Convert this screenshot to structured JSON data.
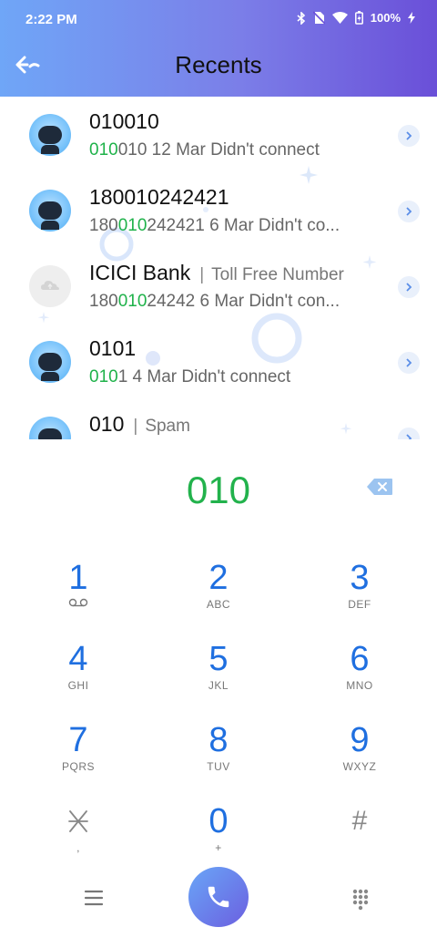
{
  "status_bar": {
    "time": "2:22 PM",
    "battery": "100%",
    "icons": [
      "bluetooth-icon",
      "no-sim-icon",
      "wifi-icon",
      "battery-charging-icon"
    ]
  },
  "header": {
    "title": "Recents",
    "back_icon": "back-arrow-icon"
  },
  "recents": [
    {
      "name": "010010",
      "tag": "",
      "number_prefix": "",
      "number_match": "010",
      "number_suffix": "010",
      "details": " 12 Mar Didn't connect",
      "avatar": "blue"
    },
    {
      "name": "180010242421",
      "tag": "",
      "number_prefix": "180",
      "number_match": "010",
      "number_suffix": "242421",
      "details": " 6 Mar Didn't co...",
      "avatar": "blue"
    },
    {
      "name": "ICICI Bank",
      "tag": "Toll Free Number",
      "number_prefix": "180",
      "number_match": "010",
      "number_suffix": "24242",
      "details": " 6 Mar Didn't con...",
      "avatar": "gray"
    },
    {
      "name": "0101",
      "tag": "",
      "number_prefix": "",
      "number_match": "010",
      "number_suffix": "1",
      "details": " 4 Mar Didn't connect",
      "avatar": "blue"
    },
    {
      "name": "010",
      "tag": "Spam",
      "number_prefix": "",
      "number_match": "",
      "number_suffix": "",
      "details": "",
      "avatar": "blue"
    }
  ],
  "dialer": {
    "number": "010",
    "backspace_icon": "backspace-icon"
  },
  "keypad": [
    {
      "digit": "1",
      "letters": "",
      "sub_icon": "voicemail-icon"
    },
    {
      "digit": "2",
      "letters": "ABC"
    },
    {
      "digit": "3",
      "letters": "DEF"
    },
    {
      "digit": "4",
      "letters": "GHI"
    },
    {
      "digit": "5",
      "letters": "JKL"
    },
    {
      "digit": "6",
      "letters": "MNO"
    },
    {
      "digit": "7",
      "letters": "PQRS"
    },
    {
      "digit": "8",
      "letters": "TUV"
    },
    {
      "digit": "9",
      "letters": "WXYZ"
    },
    {
      "digit": "*",
      "letters": ","
    },
    {
      "digit": "0",
      "letters": "+"
    },
    {
      "digit": "#",
      "letters": ""
    }
  ],
  "bottom_bar": {
    "menu_icon": "menu-icon",
    "call_icon": "phone-icon",
    "keypad_icon": "dialpad-icon"
  },
  "colors": {
    "accent_blue": "#1f6fe0",
    "match_green": "#1fb24a",
    "header_gradient_start": "#6fa6f7",
    "header_gradient_end": "#6a4fd8"
  }
}
